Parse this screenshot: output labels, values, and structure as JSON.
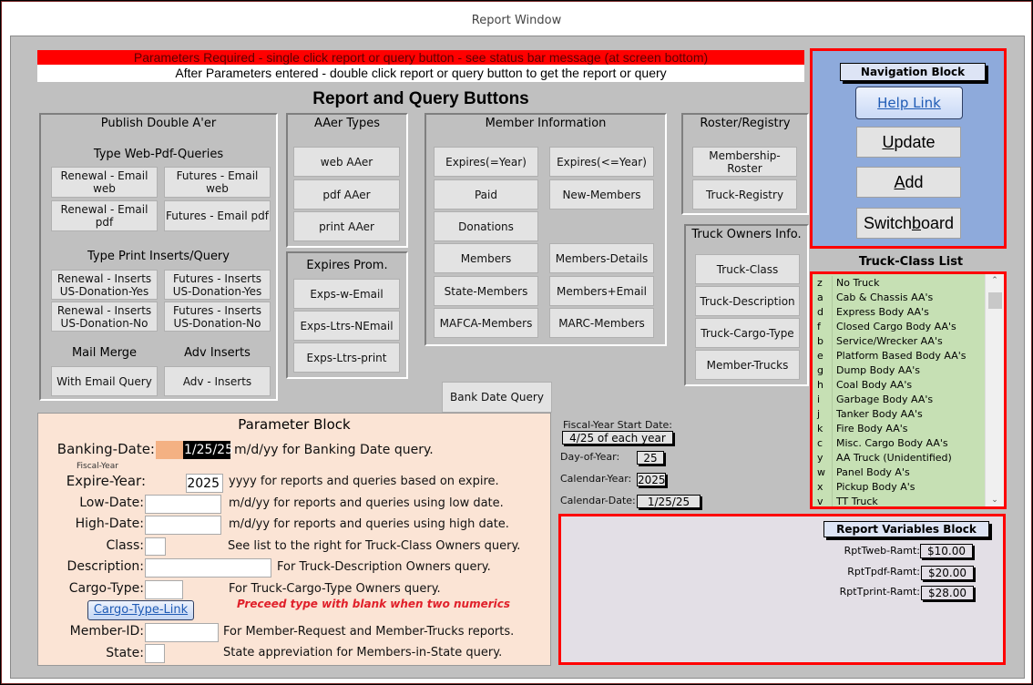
{
  "window": {
    "title": "Report Window"
  },
  "banners": {
    "required": "Parameters Required - single click report or query button - see status bar message (at screen bottom)",
    "after": "After Parameters entered - double click report or query button to get the report or query"
  },
  "heading": "Report and Query Buttons",
  "publish": {
    "title": "Publish Double A'er",
    "web_pdf_title": "Type Web-Pdf-Queries",
    "web_pdf_buttons": [
      "Renewal - Email web",
      "Futures - Email web",
      "Renewal - Email pdf",
      "Futures - Email pdf"
    ],
    "print_title": "Type Print Inserts/Query",
    "print_buttons": [
      "Renewal - Inserts US-Donation-Yes",
      "Futures - Inserts US-Donation-Yes",
      "Renewal - Inserts US-Donation-No",
      "Futures - Inserts US-Donation-No"
    ],
    "mail_merge_title": "Mail Merge",
    "adv_inserts_title": "Adv Inserts",
    "mail_merge_button": "With Email Query",
    "adv_inserts_button": "Adv - Inserts"
  },
  "aaer_types": {
    "title": "AAer Types",
    "buttons": [
      "web AAer",
      "pdf AAer",
      "print AAer"
    ]
  },
  "expires_prom": {
    "title": "Expires Prom.",
    "buttons": [
      "Exps-w-Email",
      "Exps-Ltrs-NEmail",
      "Exps-Ltrs-print"
    ]
  },
  "member_info": {
    "title": "Member Information",
    "left_buttons": [
      "Expires(=Year)",
      "Paid",
      "Donations",
      "Members",
      "State-Members",
      "MAFCA-Members"
    ],
    "right_buttons": [
      "Expires(<=Year)",
      "New-Members",
      "Members-Details",
      "Members+Email",
      "MARC-Members"
    ]
  },
  "roster": {
    "title": "Roster/Registry",
    "buttons": [
      "Membership-Roster",
      "Truck-Registry"
    ]
  },
  "truck_owners": {
    "title": "Truck Owners Info.",
    "buttons": [
      "Truck-Class",
      "Truck-Description",
      "Truck-Cargo-Type",
      "Member-Trucks"
    ]
  },
  "bank_date_query": "Bank Date Query",
  "navigation": {
    "title": "Navigation Block",
    "help_link": "Help Link",
    "update_pre": "",
    "update_u": "U",
    "update_post": "pdate",
    "add_pre": "",
    "add_u": "A",
    "add_post": "dd",
    "switch_pre": "Switch",
    "switch_u": "b",
    "switch_post": "oard"
  },
  "truck_class": {
    "title": "Truck-Class List",
    "items": [
      {
        "code": "z",
        "name": "No Truck"
      },
      {
        "code": "a",
        "name": "Cab & Chassis AA's"
      },
      {
        "code": "d",
        "name": "Express Body AA's"
      },
      {
        "code": "f",
        "name": "Closed Cargo Body AA's"
      },
      {
        "code": "b",
        "name": "Service/Wrecker AA's"
      },
      {
        "code": "e",
        "name": "Platform Based Body AA's"
      },
      {
        "code": "g",
        "name": "Dump Body AA's"
      },
      {
        "code": "h",
        "name": "Coal Body AA's"
      },
      {
        "code": "i",
        "name": "Garbage Body AA's"
      },
      {
        "code": "j",
        "name": "Tanker Body AA's"
      },
      {
        "code": "k",
        "name": "Fire Body AA's"
      },
      {
        "code": "c",
        "name": "Misc. Cargo Body AA's"
      },
      {
        "code": "y",
        "name": "AA Truck (Unidentified)"
      },
      {
        "code": "w",
        "name": "Panel Body A's"
      },
      {
        "code": "x",
        "name": "Pickup Body A's"
      },
      {
        "code": "v",
        "name": "TT Truck"
      }
    ]
  },
  "parameters": {
    "title": "Parameter Block",
    "banking_date": {
      "label": "Banking-Date:",
      "value": "1/25/25",
      "desc": "m/d/yy for Banking Date query."
    },
    "fiscal_year_note": "Fiscal-Year",
    "expire_year": {
      "label": "Expire-Year:",
      "value": "2025",
      "desc": "yyyy for reports and queries based on expire."
    },
    "low_date": {
      "label": "Low-Date:",
      "value": "",
      "desc": "m/d/yy for reports and queries using low date."
    },
    "high_date": {
      "label": "High-Date:",
      "value": "",
      "desc": "m/d/yy for reports and queries using high date."
    },
    "class": {
      "label": "Class:",
      "value": "",
      "desc": "See list to the right for Truck-Class Owners query."
    },
    "description": {
      "label": "Description:",
      "value": "",
      "desc": "For Truck-Description Owners query."
    },
    "cargo_type": {
      "label": "Cargo-Type:",
      "value": "",
      "desc": "For Truck-Cargo-Type Owners query.",
      "warning": "Preceed type with blank when two numerics"
    },
    "cargo_type_link": "Cargo-Type-Link",
    "member_id": {
      "label": "Member-ID:",
      "value": "",
      "desc": "For Member-Request and Member-Trucks reports."
    },
    "state": {
      "label": "State:",
      "value": "",
      "desc": "State appreviation for Members-in-State query."
    }
  },
  "fiscal": {
    "start_label": "Fiscal-Year Start Date:",
    "start_value": "4/25 of each year",
    "day_label": "Day-of-Year:",
    "day_value": "25",
    "cal_year_label": "Calendar-Year:",
    "cal_year_value": "2025",
    "cal_date_label": "Calendar-Date:",
    "cal_date_value": "1/25/25"
  },
  "report_vars": {
    "title": "Report Variables Block",
    "items": [
      {
        "label": "RptTweb-Ramt:",
        "value": "$10.00"
      },
      {
        "label": "RptTpdf-Ramt:",
        "value": "$20.00"
      },
      {
        "label": "RptTprint-Ramt:",
        "value": "$28.00"
      }
    ]
  },
  "colors": {
    "alert_red": "#ff0000",
    "nav_blue": "#8eaadb",
    "param_bg": "#fbe4d5",
    "list_green": "#c6e0b4",
    "form_gray": "#c0c0c0"
  }
}
